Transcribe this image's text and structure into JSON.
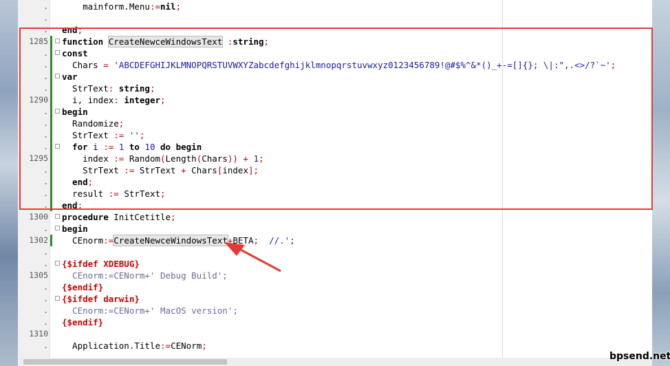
{
  "lines": [
    {
      "ln": ".",
      "mod": false,
      "fold": false,
      "tokens": [
        {
          "t": "    mainform.Menu",
          "c": "id"
        },
        {
          "t": ":=",
          "c": "op"
        },
        {
          "t": "nil",
          "c": "kw"
        },
        {
          "t": ";",
          "c": "op"
        }
      ]
    },
    {
      "ln": ".",
      "mod": false,
      "fold": false,
      "tokens": []
    },
    {
      "ln": ".",
      "mod": false,
      "fold": false,
      "tokens": [
        {
          "t": "end",
          "c": "kw"
        },
        {
          "t": ";",
          "c": "op"
        }
      ]
    },
    {
      "ln": "1285",
      "mod": true,
      "fold": true,
      "tokens": [
        {
          "t": "function ",
          "c": "kw"
        },
        {
          "t": "CreateNewceWindowsText",
          "c": "id",
          "hl": true
        },
        {
          "t": " :",
          "c": "op"
        },
        {
          "t": "string",
          "c": "kw"
        },
        {
          "t": ";",
          "c": "op"
        }
      ]
    },
    {
      "ln": ".",
      "mod": true,
      "fold": true,
      "tokens": [
        {
          "t": "const",
          "c": "kw"
        }
      ]
    },
    {
      "ln": ".",
      "mod": true,
      "fold": false,
      "tokens": [
        {
          "t": "  Chars ",
          "c": "id"
        },
        {
          "t": "= ",
          "c": "op"
        },
        {
          "t": "'ABCDEFGHIJKLMNOPQRSTUVWXYZabcdefghijklmnopqrstuvwxyz0123456789!@#$%^&*()_+-=[]{}; \\|:\",.<>/?`~'",
          "c": "str"
        },
        {
          "t": ";",
          "c": "op"
        }
      ]
    },
    {
      "ln": ".",
      "mod": true,
      "fold": true,
      "tokens": [
        {
          "t": "var",
          "c": "kw"
        }
      ]
    },
    {
      "ln": ".",
      "mod": true,
      "fold": false,
      "tokens": [
        {
          "t": "  StrText",
          "c": "id"
        },
        {
          "t": ": ",
          "c": "op"
        },
        {
          "t": "string",
          "c": "kw"
        },
        {
          "t": ";",
          "c": "op"
        }
      ]
    },
    {
      "ln": "1290",
      "mod": true,
      "fold": false,
      "tokens": [
        {
          "t": "  i, index",
          "c": "id"
        },
        {
          "t": ": ",
          "c": "op"
        },
        {
          "t": "integer",
          "c": "kw"
        },
        {
          "t": ";",
          "c": "op"
        }
      ]
    },
    {
      "ln": ".",
      "mod": true,
      "fold": true,
      "tokens": [
        {
          "t": "begin",
          "c": "kw"
        }
      ]
    },
    {
      "ln": ".",
      "mod": true,
      "fold": false,
      "tokens": [
        {
          "t": "  Randomize",
          "c": "id"
        },
        {
          "t": ";",
          "c": "op"
        }
      ]
    },
    {
      "ln": ".",
      "mod": true,
      "fold": false,
      "tokens": [
        {
          "t": "  StrText ",
          "c": "id"
        },
        {
          "t": ":= ",
          "c": "op"
        },
        {
          "t": "''",
          "c": "str"
        },
        {
          "t": ";",
          "c": "op"
        }
      ]
    },
    {
      "ln": ".",
      "mod": true,
      "fold": true,
      "tokens": [
        {
          "t": "  for ",
          "c": "kw"
        },
        {
          "t": "i ",
          "c": "id"
        },
        {
          "t": ":= ",
          "c": "op"
        },
        {
          "t": "1",
          "c": "num"
        },
        {
          "t": " to ",
          "c": "kw"
        },
        {
          "t": "10",
          "c": "num"
        },
        {
          "t": " do begin",
          "c": "kw"
        }
      ]
    },
    {
      "ln": "1295",
      "mod": true,
      "fold": false,
      "tokens": [
        {
          "t": "    index ",
          "c": "id"
        },
        {
          "t": ":= ",
          "c": "op"
        },
        {
          "t": "Random",
          "c": "id"
        },
        {
          "t": "(",
          "c": "op"
        },
        {
          "t": "Length",
          "c": "id"
        },
        {
          "t": "(",
          "c": "op"
        },
        {
          "t": "Chars",
          "c": "id"
        },
        {
          "t": ")) + ",
          "c": "op"
        },
        {
          "t": "1",
          "c": "num"
        },
        {
          "t": ";",
          "c": "op"
        }
      ]
    },
    {
      "ln": ".",
      "mod": true,
      "fold": false,
      "tokens": [
        {
          "t": "    StrText ",
          "c": "id"
        },
        {
          "t": ":= ",
          "c": "op"
        },
        {
          "t": "StrText ",
          "c": "id"
        },
        {
          "t": "+ ",
          "c": "op"
        },
        {
          "t": "Chars",
          "c": "id"
        },
        {
          "t": "[",
          "c": "op"
        },
        {
          "t": "index",
          "c": "id"
        },
        {
          "t": "];",
          "c": "op"
        }
      ]
    },
    {
      "ln": ".",
      "mod": true,
      "fold": false,
      "tokens": [
        {
          "t": "  end",
          "c": "kw"
        },
        {
          "t": ";",
          "c": "op"
        }
      ]
    },
    {
      "ln": ".",
      "mod": true,
      "fold": false,
      "tokens": [
        {
          "t": "  result ",
          "c": "id"
        },
        {
          "t": ":= ",
          "c": "op"
        },
        {
          "t": "StrText",
          "c": "id"
        },
        {
          "t": ";",
          "c": "op"
        }
      ]
    },
    {
      "ln": ".",
      "mod": true,
      "fold": false,
      "tokens": [
        {
          "t": "end",
          "c": "kw"
        },
        {
          "t": ";",
          "c": "op"
        }
      ]
    },
    {
      "ln": "1300",
      "mod": false,
      "fold": true,
      "tokens": [
        {
          "t": "procedure ",
          "c": "kw"
        },
        {
          "t": "InitCetitle",
          "c": "id"
        },
        {
          "t": ";",
          "c": "op"
        }
      ]
    },
    {
      "ln": ".",
      "mod": false,
      "fold": true,
      "tokens": [
        {
          "t": "begin",
          "c": "kw"
        }
      ]
    },
    {
      "ln": "1302",
      "mod": true,
      "fold": false,
      "tokens": [
        {
          "t": "  CEnorm",
          "c": "id"
        },
        {
          "t": ":=",
          "c": "op"
        },
        {
          "t": "CreateNewceWindowsText",
          "c": "id",
          "hl": true
        },
        {
          "t": "+",
          "c": "op"
        },
        {
          "t": "BETA",
          "c": "id"
        },
        {
          "t": ";  ",
          "c": "op"
        },
        {
          "t": "//.';",
          "c": "cmt"
        }
      ]
    },
    {
      "ln": ".",
      "mod": false,
      "fold": false,
      "tokens": []
    },
    {
      "ln": ".",
      "mod": false,
      "fold": true,
      "tokens": [
        {
          "t": "{$ifdef XDEBUG}",
          "c": "dir"
        }
      ]
    },
    {
      "ln": "1305",
      "mod": false,
      "fold": false,
      "tokens": [
        {
          "t": "  CEnorm:=CENorm+' Debug Build';",
          "c": "muted"
        }
      ]
    },
    {
      "ln": ".",
      "mod": false,
      "fold": false,
      "tokens": [
        {
          "t": "{$endif}",
          "c": "dir"
        }
      ]
    },
    {
      "ln": ".",
      "mod": false,
      "fold": true,
      "tokens": [
        {
          "t": "{$ifdef darwin}",
          "c": "dir"
        }
      ]
    },
    {
      "ln": ".",
      "mod": false,
      "fold": false,
      "tokens": [
        {
          "t": "  CEnorm:=CENorm+' MacOS version';",
          "c": "muted"
        }
      ]
    },
    {
      "ln": ".",
      "mod": false,
      "fold": false,
      "tokens": [
        {
          "t": "{$endif}",
          "c": "dir"
        }
      ]
    },
    {
      "ln": "1310",
      "mod": false,
      "fold": false,
      "tokens": []
    },
    {
      "ln": ".",
      "mod": false,
      "fold": false,
      "tokens": [
        {
          "t": "  Application.Title",
          "c": "id"
        },
        {
          "t": ":=",
          "c": "op"
        },
        {
          "t": "CENorm",
          "c": "id"
        },
        {
          "t": ";",
          "c": "op"
        }
      ]
    },
    {
      "ln": ".",
      "mod": false,
      "fold": false,
      "tokens": []
    }
  ],
  "watermark": "bpsend.net",
  "colors": {
    "highlight_box": "#e53935",
    "arrow": "#e53935",
    "modified_bar": "#2e8b2e"
  }
}
